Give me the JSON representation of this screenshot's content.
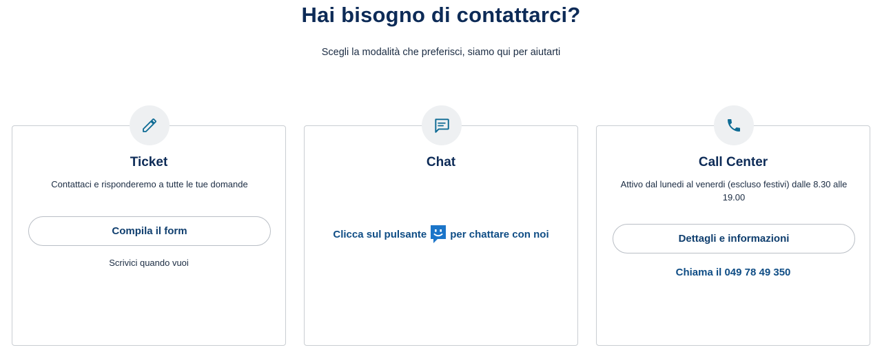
{
  "header": {
    "title": "Hai bisogno di contattarci?",
    "subtitle": "Scegli la modalità che preferisci, siamo qui per aiutarti"
  },
  "cards": {
    "ticket": {
      "icon": "pencil-icon",
      "title": "Ticket",
      "description": "Contattaci e risponderemo a tutte le tue domande",
      "button_label": "Compila il form",
      "note": "Scrivici quando vuoi"
    },
    "chat": {
      "icon": "chat-icon",
      "title": "Chat",
      "text_before": "Clicca sul pulsante",
      "chat_button_icon": "smiley-chat-icon",
      "text_after": "per chattare con noi"
    },
    "call_center": {
      "icon": "phone-icon",
      "title": "Call Center",
      "description": "Attivo dal lunedi al venerdi (escluso festivi) dalle 8.30 alle 19.00",
      "button_label": "Dettagli e informazioni",
      "phone_link": "Chiama il 049 78 49 350"
    }
  },
  "colors": {
    "title": "#0d2b57",
    "link": "#0f4d85",
    "icon": "#0e6b94",
    "chat_button": "#1b75c9",
    "icon_circle_bg": "#eef0f2",
    "card_border": "#c9cdd2"
  }
}
